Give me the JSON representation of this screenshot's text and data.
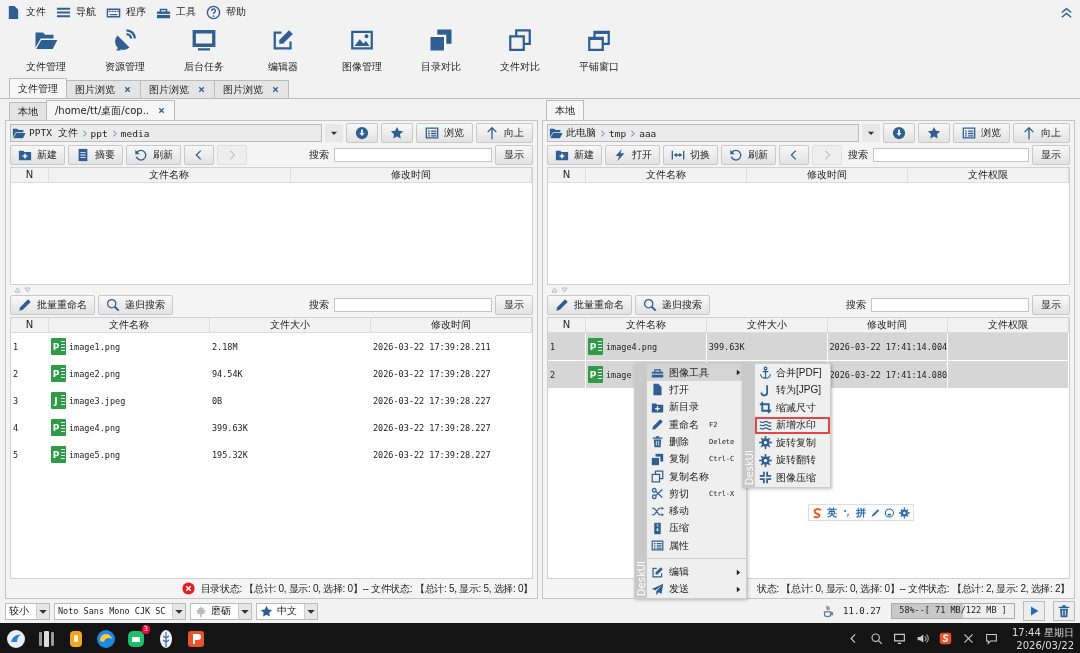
{
  "menu_bar": {
    "items": [
      {
        "kind": "file",
        "label": "文件"
      },
      {
        "kind": "nav",
        "label": "导航"
      },
      {
        "kind": "program",
        "label": "程序"
      },
      {
        "kind": "tools",
        "label": "工具"
      },
      {
        "kind": "help",
        "label": "帮助"
      }
    ]
  },
  "toolbar": [
    {
      "kind": "files",
      "label": "文件管理"
    },
    {
      "kind": "resources",
      "label": "资源管理"
    },
    {
      "kind": "tasks",
      "label": "后台任务"
    },
    {
      "kind": "editor",
      "label": "编辑器"
    },
    {
      "kind": "images",
      "label": "图像管理"
    },
    {
      "kind": "dircompare",
      "label": "目录对比"
    },
    {
      "kind": "filecompare",
      "label": "文件对比"
    },
    {
      "kind": "tile",
      "label": "平铺窗口"
    }
  ],
  "tabs": [
    {
      "label": "文件管理",
      "selected": true,
      "closable": false
    },
    {
      "label": "图片浏览",
      "selected": false,
      "closable": true
    },
    {
      "label": "图片浏览",
      "selected": false,
      "closable": true
    },
    {
      "label": "图片浏览",
      "selected": false,
      "closable": true
    }
  ],
  "panes": [
    {
      "tabs": [
        {
          "label": "本地",
          "selected": false,
          "closable": false
        },
        {
          "label": "/home/tt/桌面/cop..",
          "selected": true,
          "closable": true
        }
      ],
      "path": [
        "PPTX 文件",
        "ppt",
        "media"
      ],
      "path_buttons": [
        {
          "kind": "download"
        },
        {
          "kind": "favorite"
        },
        {
          "kind": "browse",
          "label": "浏览"
        },
        {
          "kind": "up",
          "label": "向上"
        }
      ],
      "actions": [
        {
          "kind": "new",
          "label": "新建",
          "disabled": false
        },
        {
          "kind": "summary",
          "label": "摘要",
          "disabled": false
        },
        {
          "kind": "refresh",
          "label": "刷新",
          "disabled": false
        },
        {
          "kind": "back",
          "disabled": false
        },
        {
          "kind": "forward",
          "disabled": true
        }
      ],
      "search_label": "搜索",
      "show_button": "显示",
      "dir_table": {
        "columns": [
          "N",
          "文件名称",
          "修改时间"
        ]
      },
      "file_actions": [
        {
          "kind": "batchrename",
          "label": "批量重命名"
        },
        {
          "kind": "recursive",
          "label": "递归搜索"
        }
      ],
      "file_search_label": "搜索",
      "file_show_button": "显示",
      "file_table": {
        "columns": [
          "N",
          "文件名称",
          "文件大小",
          "修改时间"
        ],
        "rows": [
          {
            "n": "1",
            "type_letter": "P",
            "name": "image1.png",
            "size": "2.18M",
            "modified": "2026-03-22 17:39:28.211",
            "selected": false
          },
          {
            "n": "2",
            "type_letter": "P",
            "name": "image2.png",
            "size": "94.54K",
            "modified": "2026-03-22 17:39:28.227",
            "selected": false
          },
          {
            "n": "3",
            "type_letter": "J",
            "name": "image3.jpeg",
            "size": "0B",
            "modified": "2026-03-22 17:39:28.227",
            "selected": false
          },
          {
            "n": "4",
            "type_letter": "P",
            "name": "image4.png",
            "size": "399.63K",
            "modified": "2026-03-22 17:39:28.227",
            "selected": false
          },
          {
            "n": "5",
            "type_letter": "P",
            "name": "image5.png",
            "size": "195.32K",
            "modified": "2026-03-22 17:39:28.227",
            "selected": false
          }
        ]
      },
      "status": {
        "error": true,
        "text": "目录状态: 【总计: 0, 显示: 0, 选择: 0】-- 文件状态: 【总计: 5, 显示: 5, 选择: 0】"
      }
    },
    {
      "tabs": [
        {
          "label": "本地",
          "selected": true,
          "closable": false
        }
      ],
      "path": [
        "此电脑",
        "tmp",
        "aaa"
      ],
      "path_buttons": [
        {
          "kind": "download"
        },
        {
          "kind": "favorite"
        },
        {
          "kind": "browse",
          "label": "浏览"
        },
        {
          "kind": "up",
          "label": "向上"
        }
      ],
      "actions": [
        {
          "kind": "new",
          "label": "新建",
          "disabled": false
        },
        {
          "kind": "open",
          "label": "打开",
          "disabled": false
        },
        {
          "kind": "switch",
          "label": "切换",
          "disabled": false
        },
        {
          "kind": "refresh",
          "label": "刷新",
          "disabled": false
        },
        {
          "kind": "back",
          "disabled": false
        },
        {
          "kind": "forward",
          "disabled": true
        }
      ],
      "search_label": "搜索",
      "show_button": "显示",
      "dir_table": {
        "columns": [
          "N",
          "文件名称",
          "修改时间",
          "文件权限"
        ]
      },
      "file_actions": [
        {
          "kind": "batchrename",
          "label": "批量重命名"
        },
        {
          "kind": "recursive",
          "label": "递归搜索"
        }
      ],
      "file_search_label": "搜索",
      "file_show_button": "显示",
      "file_table": {
        "columns": [
          "N",
          "文件名称",
          "文件大小",
          "修改时间",
          "文件权限"
        ],
        "rows": [
          {
            "n": "1",
            "type_letter": "P",
            "name": "image4.png",
            "size": "399.63K",
            "modified": "2026-03-22 17:41:14.004",
            "selected": true
          },
          {
            "n": "2",
            "type_letter": "P",
            "name": "image",
            "modified": "2026-03-22 17:41:14.080",
            "selected": true
          }
        ]
      },
      "status": {
        "error": false,
        "text": "状态: 【总计: 0, 显示: 0, 选择: 0】-- 文件状态: 【总计: 2, 显示: 2, 选择: 2】"
      }
    }
  ],
  "context_menu": {
    "brand": "DeskUI",
    "groups": [
      [
        {
          "kind": "imagetools",
          "label": "图像工具",
          "submenu": true,
          "highlighted": true
        },
        {
          "kind": "openfile",
          "label": "打开",
          "submenu": false,
          "highlighted": false
        },
        {
          "kind": "mkdir",
          "label": "新目录",
          "submenu": false,
          "highlighted": false
        },
        {
          "kind": "rename",
          "label": "重命名",
          "shortcut": "F2",
          "submenu": false,
          "highlighted": false
        },
        {
          "kind": "delete",
          "label": "删除",
          "shortcut": "Delete",
          "submenu": false,
          "highlighted": false
        },
        {
          "kind": "copy",
          "label": "复制",
          "shortcut": "Ctrl-C",
          "submenu": false,
          "highlighted": false
        },
        {
          "kind": "copyname",
          "label": "复制名称",
          "submenu": false,
          "highlighted": false
        },
        {
          "kind": "cut",
          "label": "剪切",
          "shortcut": "Ctrl-X",
          "submenu": false,
          "highlighted": false
        },
        {
          "kind": "move",
          "label": "移动",
          "submenu": false,
          "highlighted": false
        },
        {
          "kind": "compress",
          "label": "压缩",
          "submenu": false,
          "highlighted": false
        },
        {
          "kind": "properties",
          "label": "属性",
          "submenu": false,
          "highlighted": false
        }
      ],
      [
        {
          "kind": "edit",
          "label": "编辑",
          "submenu": true,
          "highlighted": false
        },
        {
          "kind": "send",
          "label": "发送",
          "submenu": true,
          "highlighted": false
        }
      ]
    ]
  },
  "submenu": {
    "brand": "DeskUI",
    "items": [
      {
        "kind": "merge",
        "label": "合并[PDF]",
        "outlined": false
      },
      {
        "kind": "tojpg",
        "label": "转为[JPG]",
        "outlined": false
      },
      {
        "kind": "resize",
        "label": "缩减尺寸",
        "outlined": false
      },
      {
        "kind": "watermark",
        "label": "新增水印",
        "outlined": true
      },
      {
        "kind": "rotatecopy",
        "label": "旋转复制",
        "outlined": false
      },
      {
        "kind": "rotateflip",
        "label": "旋转翻转",
        "outlined": false
      },
      {
        "kind": "shrink",
        "label": "图像压缩",
        "outlined": false
      }
    ]
  },
  "ime_bar": {
    "mode": "英",
    "layout": "拼"
  },
  "bottom_bar": {
    "dropdowns": [
      {
        "kind": "size",
        "value": "较小"
      },
      {
        "kind": "font",
        "value": "Noto Sans Mono CJK SC"
      },
      {
        "kind": "theme",
        "value": "磨砺"
      },
      {
        "kind": "language",
        "value": "中文"
      }
    ],
    "java_version": "11.0.27",
    "memory": {
      "level": 0.58,
      "text": "58%--[ 71 MB/122 MB ]"
    }
  },
  "taskbar": {
    "badge": "3",
    "time": "17:44 星期日",
    "date": "2026/03/22"
  }
}
